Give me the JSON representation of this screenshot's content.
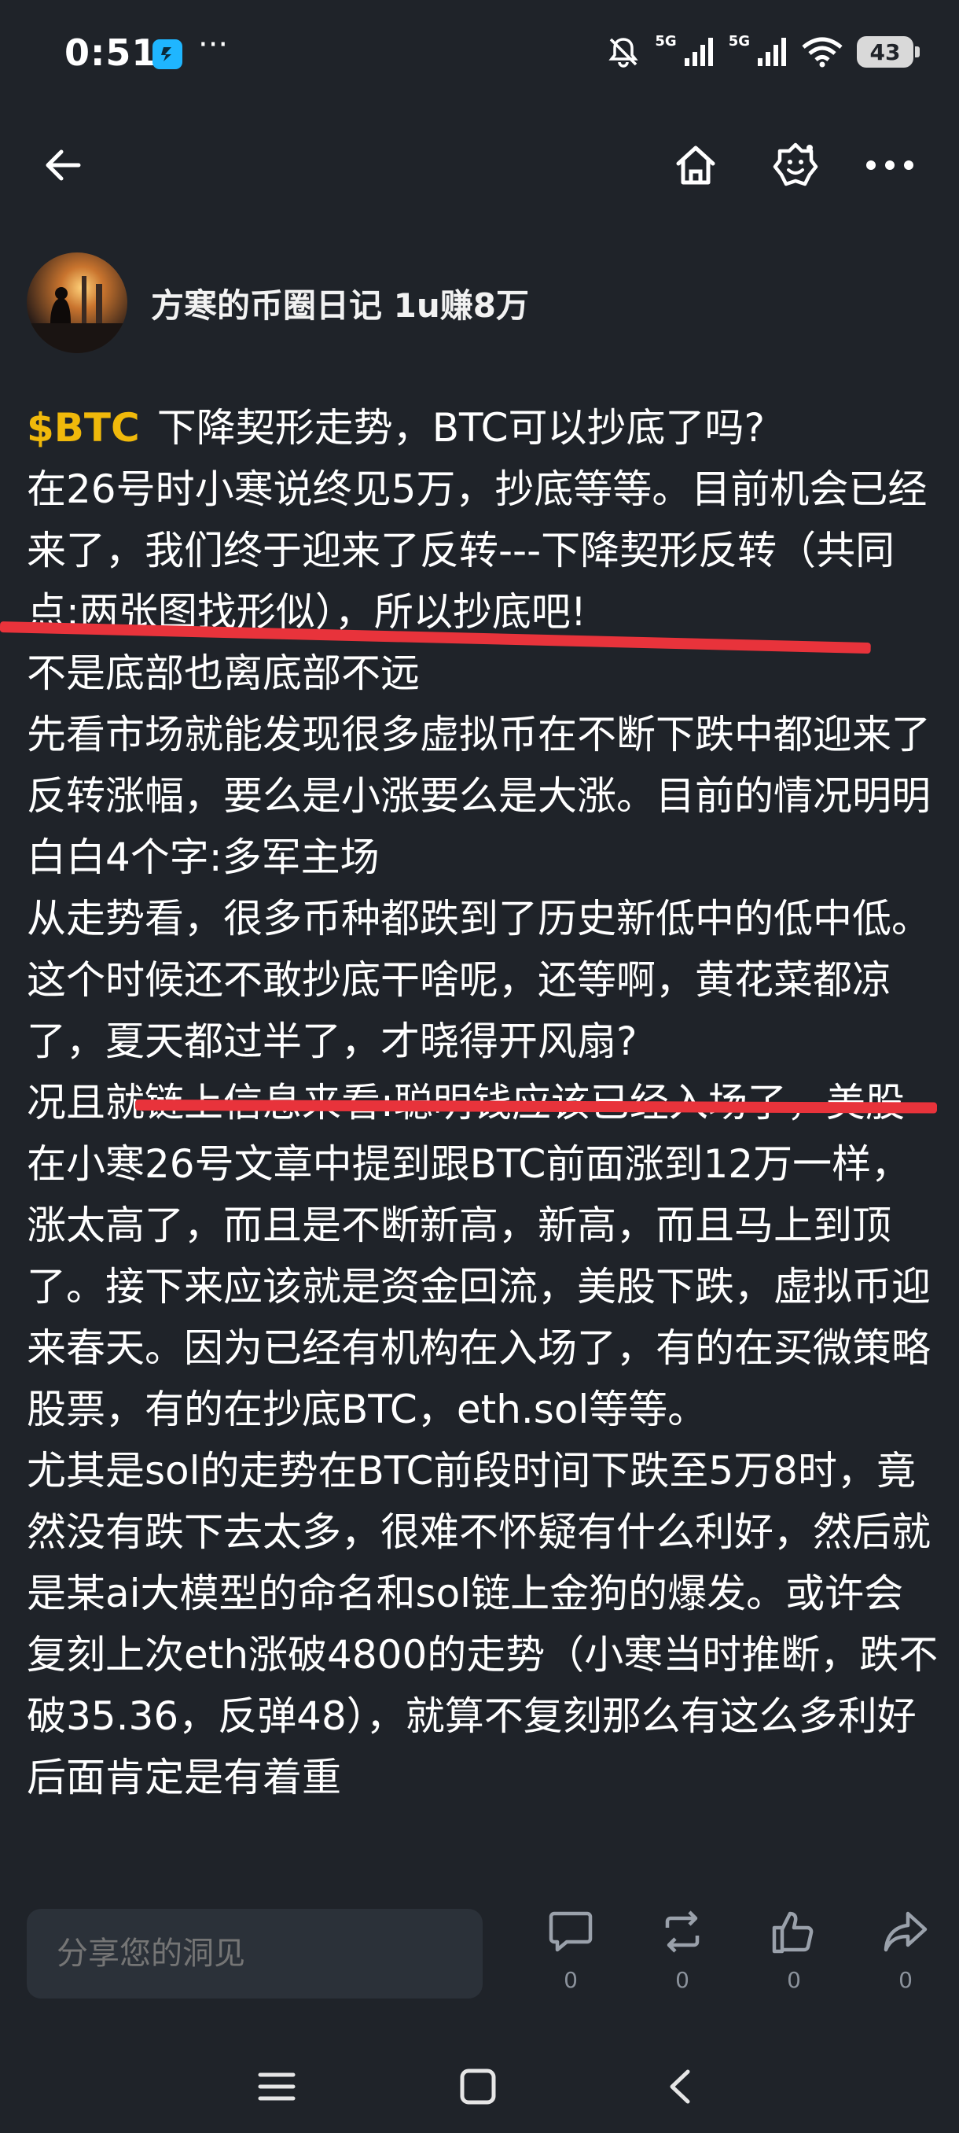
{
  "status_bar": {
    "time": "0:51",
    "overflow": "···",
    "network_1": "5G",
    "network_2": "5G",
    "battery": "43"
  },
  "author": {
    "name": "方寒的币圈日记 1u赚8万"
  },
  "post": {
    "cashtag": "$BTC",
    "lines": [
      "下降契形走势，BTC可以抄底了吗?",
      "在26号时小寒说终见5万，抄底等等。目前机会已经来了，我们终于迎来了反转---下降契形反转（共同点:两张图找形似），所以抄底吧!",
      "不是底部也离底部不远",
      "先看市场就能发现很多虚拟币在不断下跌中都迎来了反转涨幅，要么是小涨要么是大涨。目前的情况明明白白4个字:多军主场",
      "从走势看，很多币种都跌到了历史新低中的低中低。这个时候还不敢抄底干啥呢，还等啊，黄花菜都凉了，夏天都过半了，才晓得开风扇?",
      "况且就链上信息来看:聪明钱应该已经入场了，美股在小寒26号文章中提到跟BTC前面涨到12万一样，涨太高了，而且是不断新高，新高，而且马上到顶了。接下来应该就是资金回流，美股下跌，虚拟币迎来春天。因为已经有机构在入场了，有的在买微策略股票，有的在抄底BTC，eth.sol等等。",
      "尤其是sol的走势在BTC前段时间下跌至5万8时，竟然没有跌下去太多，很难不怀疑有什么利好，然后就是某ai大模型的命名和sol链上金狗的爆发。或许会复刻上次eth涨破4800的走势（小寒当时推断，跌不破35.36，反弹48），就算不复刻那么有这么多利好后面肯定是有着重"
    ]
  },
  "comment_box": {
    "placeholder": "分享您的洞见"
  },
  "actions": {
    "comment_count": "0",
    "repost_count": "0",
    "like_count": "0",
    "share_count": "0"
  },
  "colors": {
    "background": "#1f2329",
    "cashtag": "#f0b90b",
    "annotation_red": "#e8333b"
  }
}
